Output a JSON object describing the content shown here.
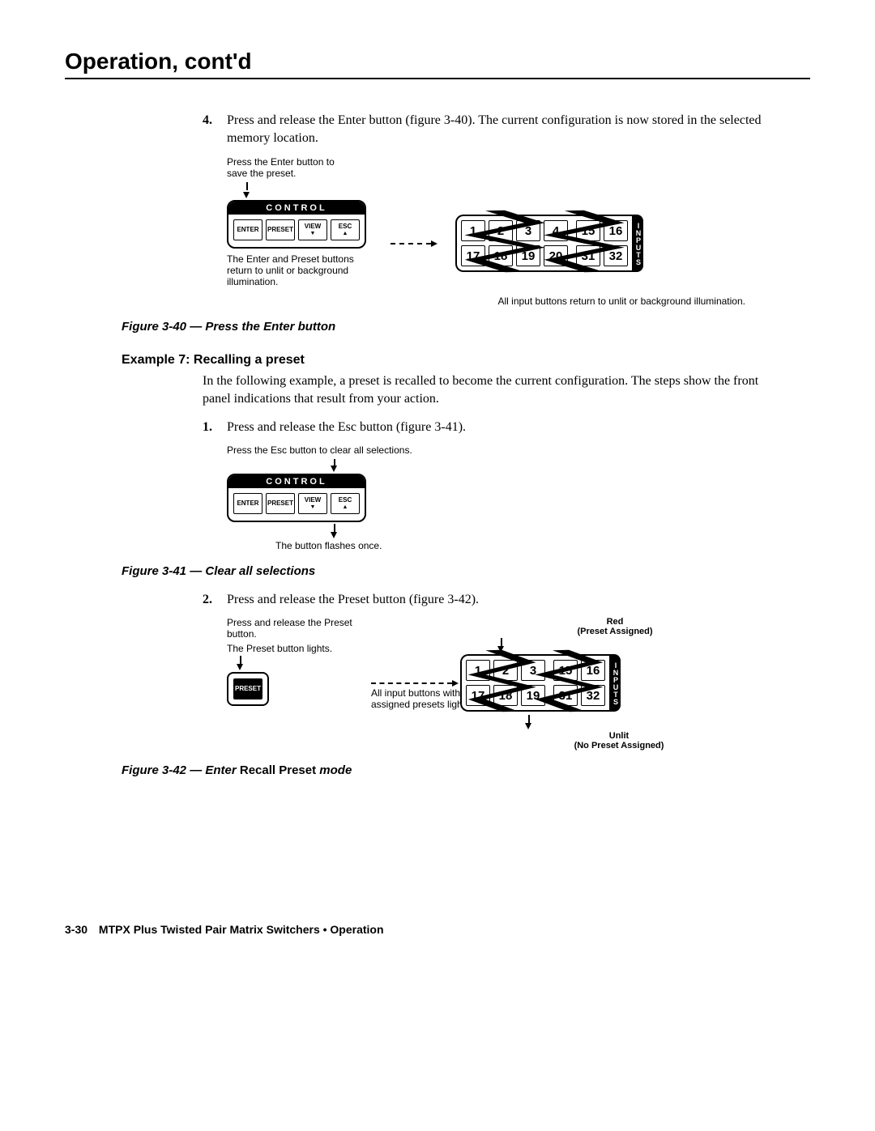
{
  "pageTitle": "Operation, cont'd",
  "step4": {
    "num": "4.",
    "text": "Press and release the Enter button (figure 3-40).  The current configuration is now stored in the selected memory location."
  },
  "fig40": {
    "instr1": "Press the Enter button to save the preset.",
    "controlTitle": "CONTROL",
    "btns": {
      "enter": "ENTER",
      "preset": "PRESET",
      "view": "VIEW",
      "esc": "ESC"
    },
    "note1": "The Enter and Preset buttons return to unlit or background illumination.",
    "topRow": [
      "1",
      "2",
      "3",
      "4"
    ],
    "topRow2": [
      "15",
      "16"
    ],
    "botRow": [
      "17",
      "18",
      "19",
      "20"
    ],
    "botRow2": [
      "31",
      "32"
    ],
    "inputsLabel": "INPUTS",
    "bottomNote": "All input buttons return to unlit or background illumination.",
    "caption": "Figure 3-40 — Press the Enter button"
  },
  "example7": {
    "heading": "Example 7: Recalling a preset",
    "intro": "In the following example, a preset is recalled to become the current configuration. The steps show the front panel indications that result from your action."
  },
  "step1": {
    "num": "1.",
    "text": "Press and release the Esc button (figure 3-41)."
  },
  "fig41": {
    "instr": "Press the Esc button to clear all selections.",
    "controlTitle": "CONTROL",
    "btns": {
      "enter": "ENTER",
      "preset": "PRESET",
      "view": "VIEW",
      "esc": "ESC"
    },
    "flash": "The button flashes once.",
    "caption": "Figure 3-41 — Clear all selections"
  },
  "step2": {
    "num": "2.",
    "text": "Press and release the Preset button (figure 3-42)."
  },
  "fig42": {
    "instr1": "Press and release the Preset button.",
    "instr2": "The Preset button lights.",
    "presetBtn": "PRESET",
    "note1": "All input buttons with assigned presets light red.",
    "redLabel1": "Red",
    "redLabel2": "(Preset Assigned)",
    "unlit1": "Unlit",
    "unlit2": "(No Preset Assigned)",
    "topRow": [
      "1",
      "2",
      "3"
    ],
    "topRow2": [
      "15",
      "16"
    ],
    "botRow": [
      "17",
      "18",
      "19"
    ],
    "botRow2": [
      "31",
      "32"
    ],
    "inputsLabel": "INPUTS",
    "captionPre": "Figure 3-42 — Enter ",
    "captionBold": "Recall Preset",
    "captionPost": " mode"
  },
  "footer": {
    "pageNum": "3-30",
    "text": "MTPX Plus Twisted Pair Matrix Switchers • Operation"
  }
}
